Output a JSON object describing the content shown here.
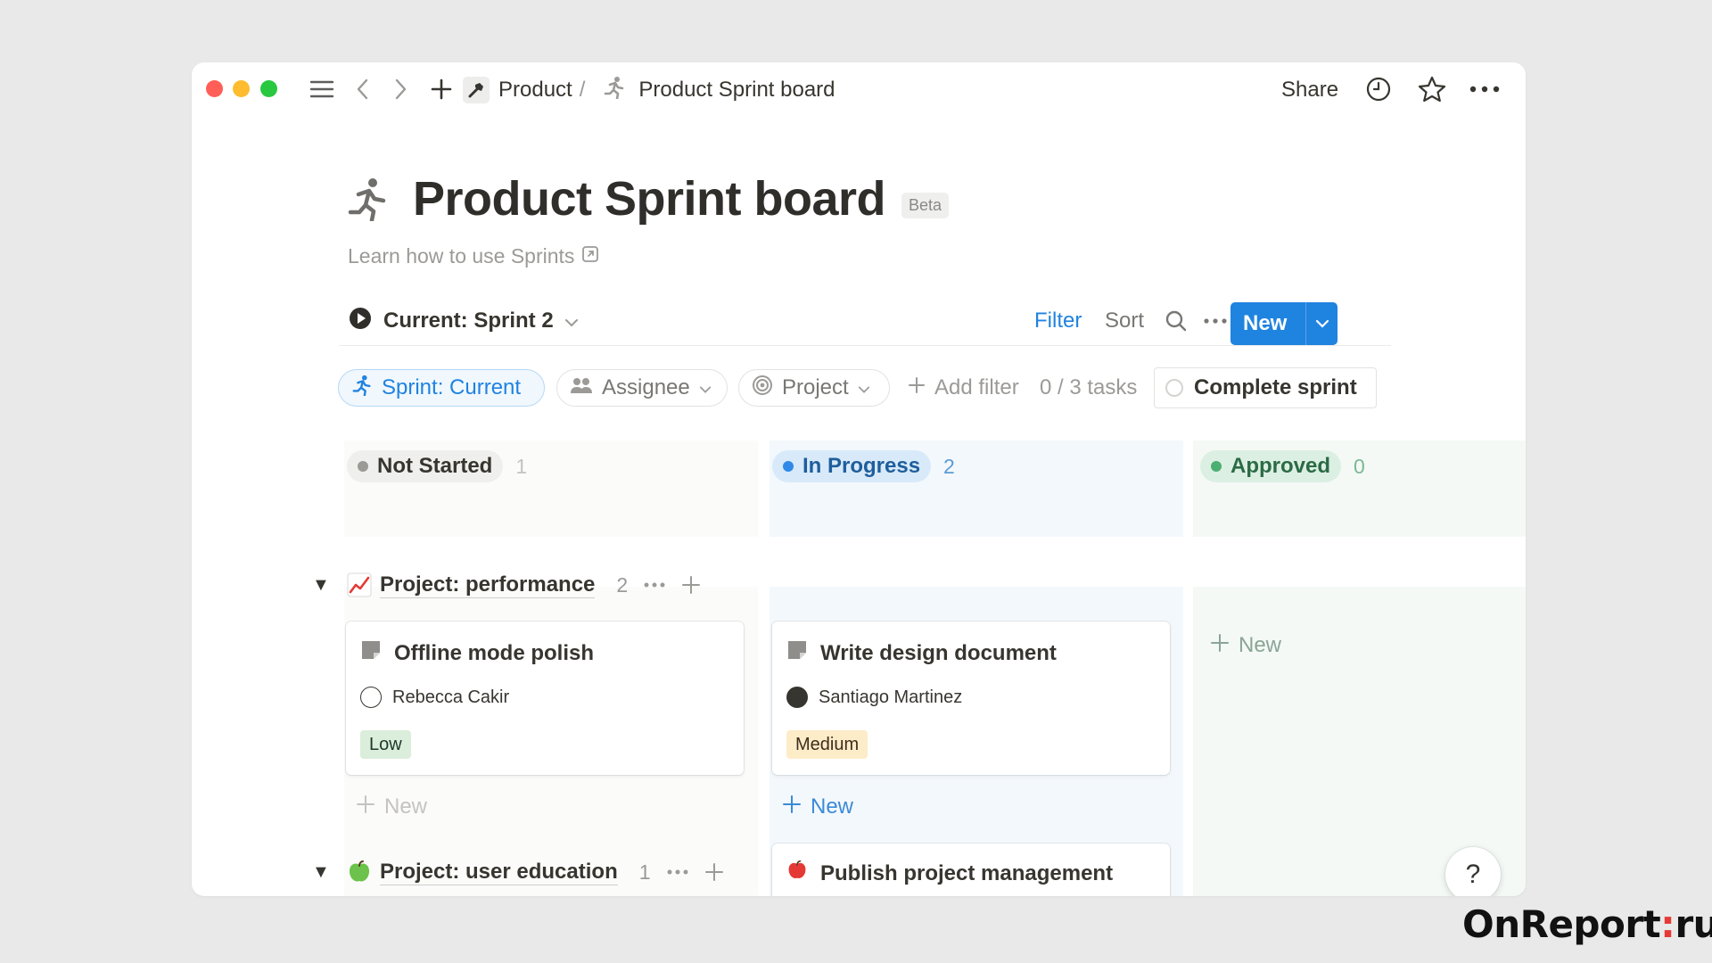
{
  "topbar": {
    "breadcrumb_parent": "Product",
    "breadcrumb_sep": "/",
    "breadcrumb_current": "Product Sprint board",
    "share_label": "Share"
  },
  "page": {
    "title": "Product Sprint board",
    "badge": "Beta",
    "learn_link": "Learn how to use Sprints"
  },
  "viewbar": {
    "current_view": "Current: Sprint 2",
    "filter_label": "Filter",
    "sort_label": "Sort",
    "new_label": "New"
  },
  "filters": {
    "sprint_chip": "Sprint: Current",
    "assignee_chip": "Assignee",
    "project_chip": "Project",
    "add_filter": "Add filter",
    "task_progress": "0 / 3 tasks",
    "complete_sprint": "Complete sprint"
  },
  "columns": [
    {
      "label": "Not Started",
      "count": "1",
      "dot_color": "#9b9a97",
      "pill_bg": "#efefed",
      "text_color": "#37352f"
    },
    {
      "label": "In Progress",
      "count": "2",
      "dot_color": "#2e8ae6",
      "pill_bg": "#d8eaf9",
      "text_color": "#1f5e9c"
    },
    {
      "label": "Approved",
      "count": "0",
      "dot_color": "#4caf72",
      "pill_bg": "#dcefe3",
      "text_color": "#2b6b45"
    }
  ],
  "groups": [
    {
      "name": "Project: performance",
      "count": "2",
      "icon": "chart-increasing-icon"
    },
    {
      "name": "Project: user education",
      "count": "1",
      "icon": "green-apple-icon"
    }
  ],
  "cards": [
    {
      "title": "Offline mode polish",
      "assignee": "Rebecca Cakir",
      "priority": "Low",
      "tag_bg": "#dbeddb",
      "tag_color": "#1c3829"
    },
    {
      "title": "Write design document",
      "assignee": "Santiago Martinez",
      "priority": "Medium",
      "tag_bg": "#fdecc8",
      "tag_color": "#402c1b"
    },
    {
      "title": "Publish project management",
      "icon": "red-apple-icon"
    }
  ],
  "new_label": "New",
  "help_label": "?",
  "watermark": {
    "left": "OnReport",
    "colon": ":",
    "right": "ru"
  }
}
